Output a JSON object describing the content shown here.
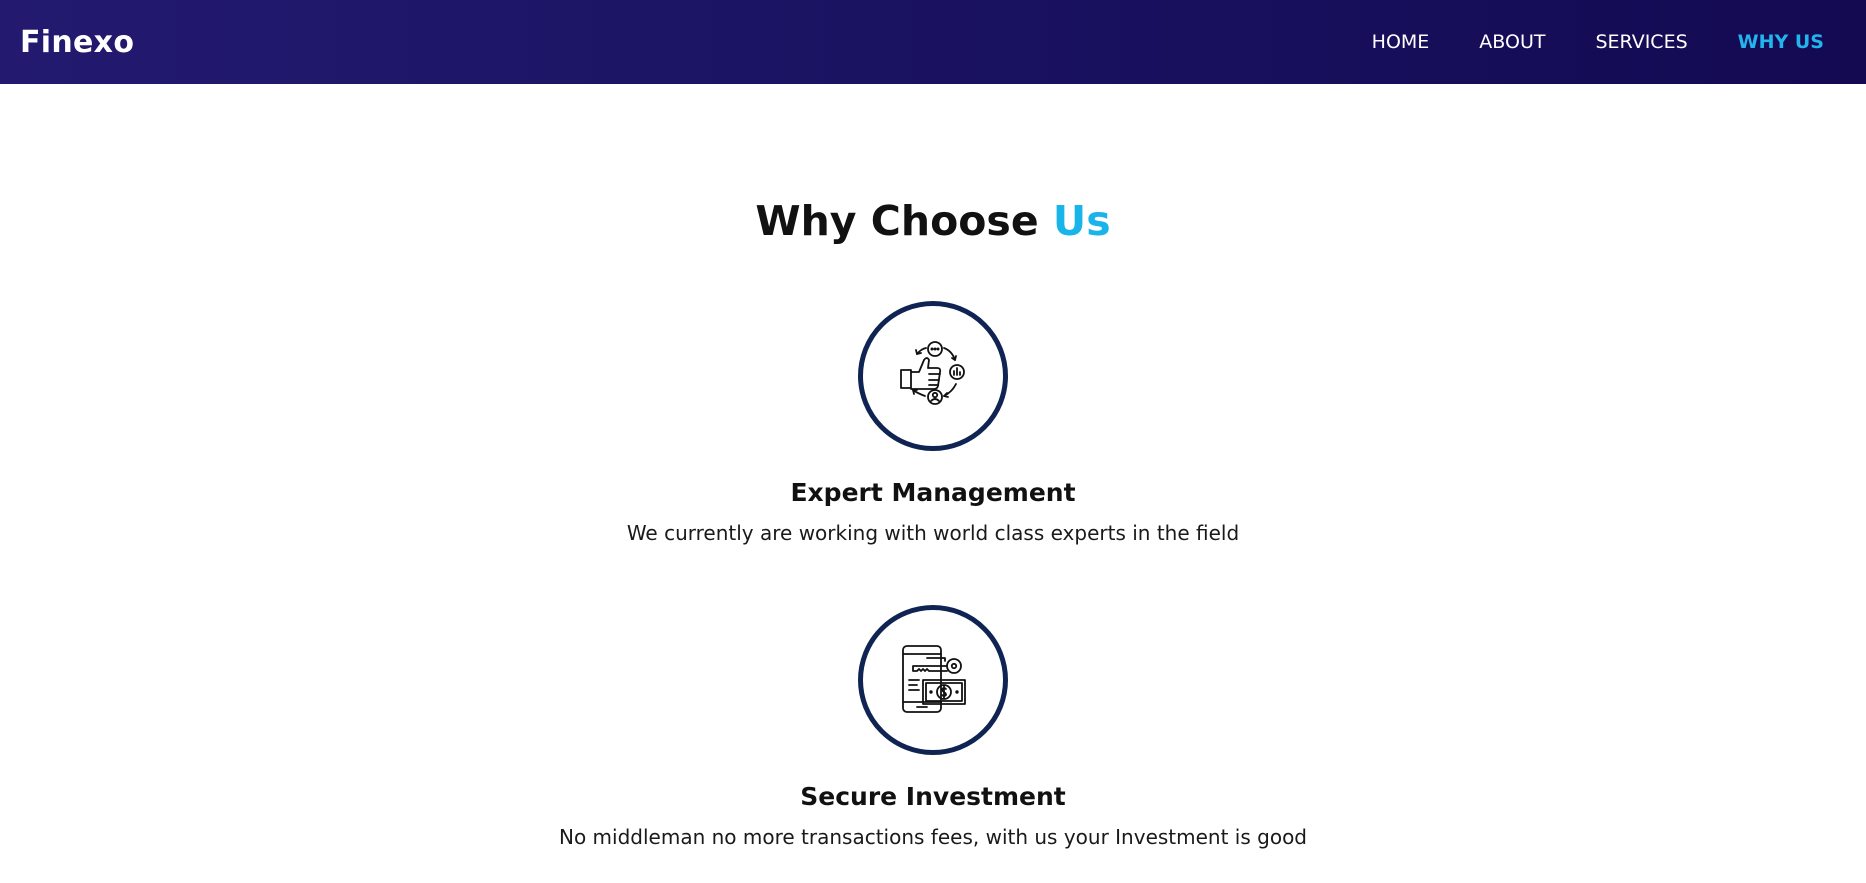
{
  "header": {
    "logo": "Finexo",
    "nav": [
      {
        "label": "HOME",
        "active": false
      },
      {
        "label": "ABOUT",
        "active": false
      },
      {
        "label": "SERVICES",
        "active": false
      },
      {
        "label": "WHY US",
        "active": true
      }
    ]
  },
  "section": {
    "title_main": "Why Choose ",
    "title_accent": "Us",
    "features": [
      {
        "icon": "thumbs-up-cycle-icon",
        "title": "Expert Management",
        "description": "We currently are working with world class experts in the field"
      },
      {
        "icon": "phone-key-money-icon",
        "title": "Secure Investment",
        "description": "No middleman no more transactions fees, with us your Investment is good"
      }
    ]
  },
  "colors": {
    "nav_bg": "#1b1464",
    "accent": "#18b4ea",
    "circle_border": "#0f2452"
  }
}
